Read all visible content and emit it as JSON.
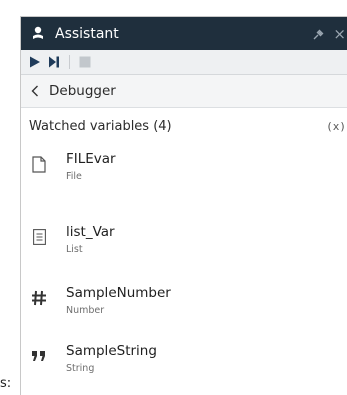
{
  "stray_text": "s:",
  "panel": {
    "title": "Assistant",
    "close_glyph": "×",
    "toolbar": {
      "buttons": [
        {
          "name": "run-button",
          "icon": "play-icon"
        },
        {
          "name": "step-button",
          "icon": "step-icon"
        },
        {
          "name": "stop-button",
          "icon": "stop-icon"
        }
      ]
    },
    "nav": {
      "back_label": "<",
      "title": "Debugger"
    },
    "watched": {
      "heading": "Watched variables (4)",
      "fx_label": "(x)",
      "variables": [
        {
          "name": "FILEvar",
          "type": "File",
          "icon": "file-icon"
        },
        {
          "name": "list_Var",
          "type": "List",
          "icon": "list-icon"
        },
        {
          "name": "SampleNumber",
          "type": "Number",
          "icon": "hash-icon"
        },
        {
          "name": "SampleString",
          "type": "String",
          "icon": "quote-icon"
        }
      ]
    },
    "colors": {
      "titlebar_bg": "#1f2f3d",
      "toolbar_icon_active": "#1f3b5a",
      "toolbar_icon_disabled": "#c2c7cc"
    }
  }
}
